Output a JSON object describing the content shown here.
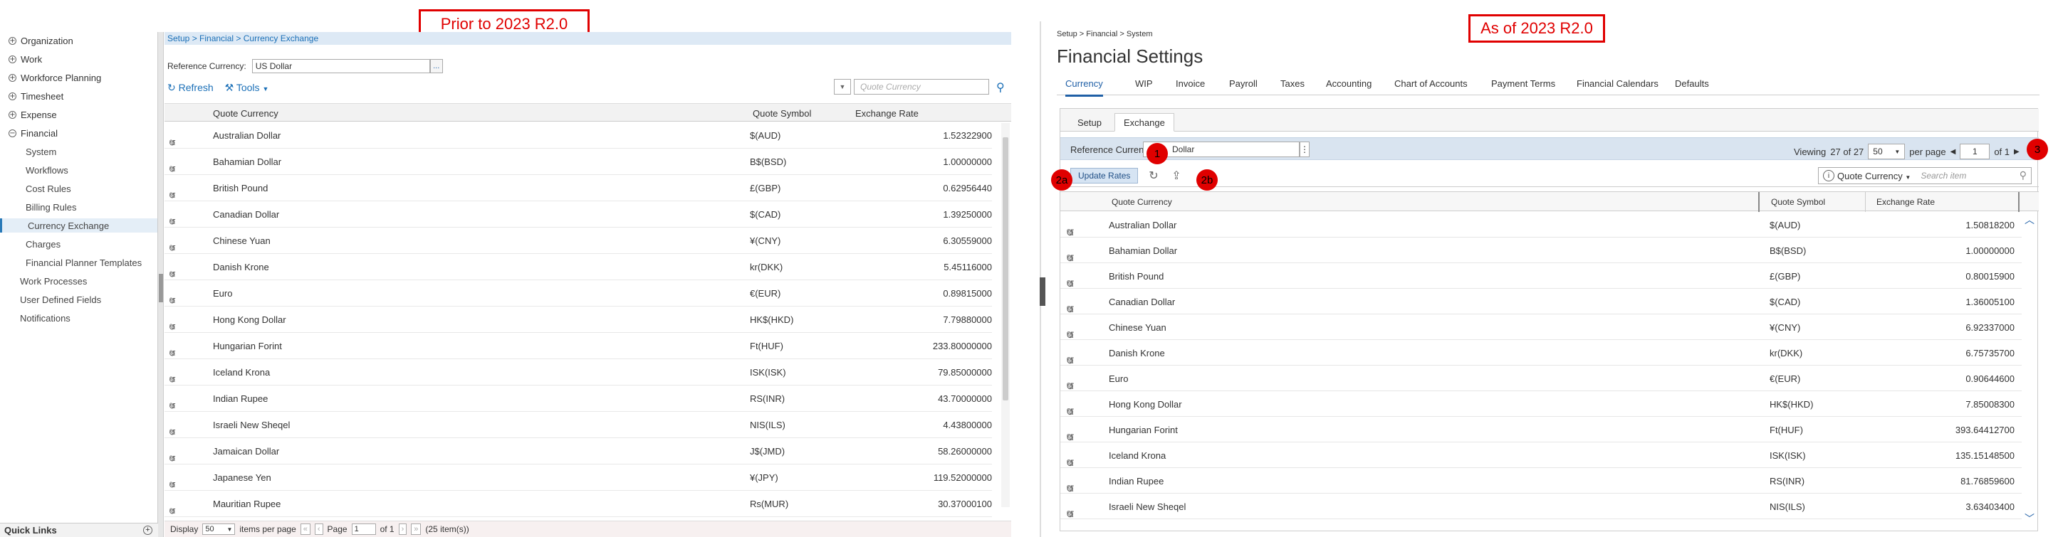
{
  "callouts": {
    "old_label": "Prior to 2023 R2.0",
    "new_label": "As of 2023 R2.0"
  },
  "badges": [
    "1",
    "2a",
    "2b",
    "3"
  ],
  "colors": {
    "accent": "#1f5fa6",
    "callout": "#e00000",
    "refbar": "#d9e4f0"
  },
  "old": {
    "sidebar": {
      "top_items": [
        {
          "label": "Organization",
          "sign": "+"
        },
        {
          "label": "Work",
          "sign": "+"
        },
        {
          "label": "Workforce Planning",
          "sign": "+"
        },
        {
          "label": "Timesheet",
          "sign": "+"
        },
        {
          "label": "Expense",
          "sign": "+"
        },
        {
          "label": "Financial",
          "sign": "−"
        }
      ],
      "financial_items": [
        "System",
        "Workflows",
        "Cost Rules",
        "Billing Rules",
        "Currency Exchange",
        "Charges",
        "Financial Planner Templates"
      ],
      "bottom_items": [
        "Work Processes",
        "User Defined Fields",
        "Notifications"
      ],
      "quick_links": "Quick Links"
    },
    "breadcrumb": "Setup > Financial > Currency Exchange",
    "reference_label": "Reference Currency:",
    "reference_value": "US Dollar",
    "dots": "...",
    "refresh": "Refresh",
    "tools": "Tools",
    "search_placeholder": "Quote Currency",
    "columns": [
      "Quote Currency",
      "Quote Symbol",
      "Exchange Rate"
    ],
    "rows": [
      [
        "Australian Dollar",
        "$(AUD)",
        "1.52322900"
      ],
      [
        "Bahamian Dollar",
        "B$(BSD)",
        "1.00000000"
      ],
      [
        "British Pound",
        "£(GBP)",
        "0.62956440"
      ],
      [
        "Canadian Dollar",
        "$(CAD)",
        "1.39250000"
      ],
      [
        "Chinese Yuan",
        "¥(CNY)",
        "6.30559000"
      ],
      [
        "Danish Krone",
        "kr(DKK)",
        "5.45116000"
      ],
      [
        "Euro",
        "€(EUR)",
        "0.89815000"
      ],
      [
        "Hong Kong Dollar",
        "HK$(HKD)",
        "7.79880000"
      ],
      [
        "Hungarian Forint",
        "Ft(HUF)",
        "233.80000000"
      ],
      [
        "Iceland Krona",
        "ISK(ISK)",
        "79.85000000"
      ],
      [
        "Indian Rupee",
        "RS(INR)",
        "43.70000000"
      ],
      [
        "Israeli New Sheqel",
        "NIS(ILS)",
        "4.43800000"
      ],
      [
        "Jamaican Dollar",
        "J$(JMD)",
        "58.26000000"
      ],
      [
        "Japanese Yen",
        "¥(JPY)",
        "119.52000000"
      ],
      [
        "Mauritian Rupee",
        "Rs(MUR)",
        "30.37000100"
      ]
    ],
    "pager": {
      "display": "Display",
      "per_page": "50",
      "items_per_page": "items per page",
      "page": "Page",
      "page_value": "1",
      "of": "of 1",
      "items": "(25 item(s))"
    }
  },
  "new": {
    "breadcrumb": "Setup > Financial > System",
    "title": "Financial Settings",
    "tabs": [
      "Currency",
      "WIP",
      "Invoice",
      "Payroll",
      "Taxes",
      "Accounting",
      "Chart of Accounts",
      "Payment Terms",
      "Financial Calendars",
      "Defaults"
    ],
    "subtabs": [
      "Setup",
      "Exchange"
    ],
    "reference_label": "Reference Currency",
    "reference_value": "Dollar",
    "viewing_label": "Viewing",
    "viewing_count": "27 of 27",
    "per_page_value": "50",
    "per_page_label": "per page",
    "page_value": "1",
    "of": "of 1",
    "update_rates": "Update Rates",
    "search_field": "Quote Currency",
    "search_placeholder": "Search item",
    "columns": [
      "Quote Currency",
      "Quote Symbol",
      "Exchange Rate"
    ],
    "rows": [
      [
        "Australian Dollar",
        "$(AUD)",
        "1.50818200"
      ],
      [
        "Bahamian Dollar",
        "B$(BSD)",
        "1.00000000"
      ],
      [
        "British Pound",
        "£(GBP)",
        "0.80015900"
      ],
      [
        "Canadian Dollar",
        "$(CAD)",
        "1.36005100"
      ],
      [
        "Chinese Yuan",
        "¥(CNY)",
        "6.92337000"
      ],
      [
        "Danish Krone",
        "kr(DKK)",
        "6.75735700"
      ],
      [
        "Euro",
        "€(EUR)",
        "0.90644600"
      ],
      [
        "Hong Kong Dollar",
        "HK$(HKD)",
        "7.85008300"
      ],
      [
        "Hungarian Forint",
        "Ft(HUF)",
        "393.64412700"
      ],
      [
        "Iceland Krona",
        "ISK(ISK)",
        "135.15148500"
      ],
      [
        "Indian Rupee",
        "RS(INR)",
        "81.76859600"
      ],
      [
        "Israeli New Sheqel",
        "NIS(ILS)",
        "3.63403400"
      ]
    ]
  }
}
